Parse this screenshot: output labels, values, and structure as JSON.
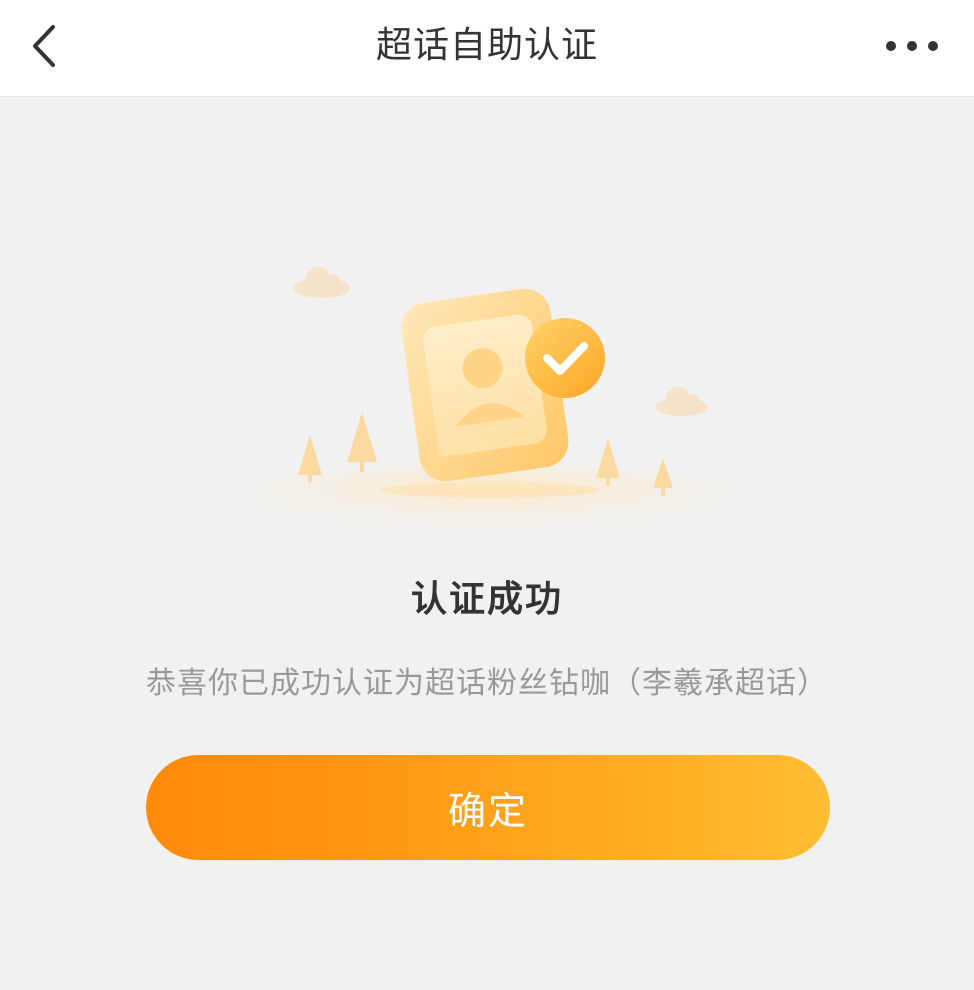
{
  "header": {
    "title": "超话自助认证",
    "back_icon": "chevron-left-icon",
    "more_icon": "more-dots-icon"
  },
  "result": {
    "title": "认证成功",
    "description": "恭喜你已成功认证为超话粉丝钻咖（李羲承超话）"
  },
  "actions": {
    "confirm_label": "确定"
  },
  "colors": {
    "accent_start": "#ff8a0c",
    "accent_end": "#ffbd33",
    "background": "#f1f1f1"
  }
}
